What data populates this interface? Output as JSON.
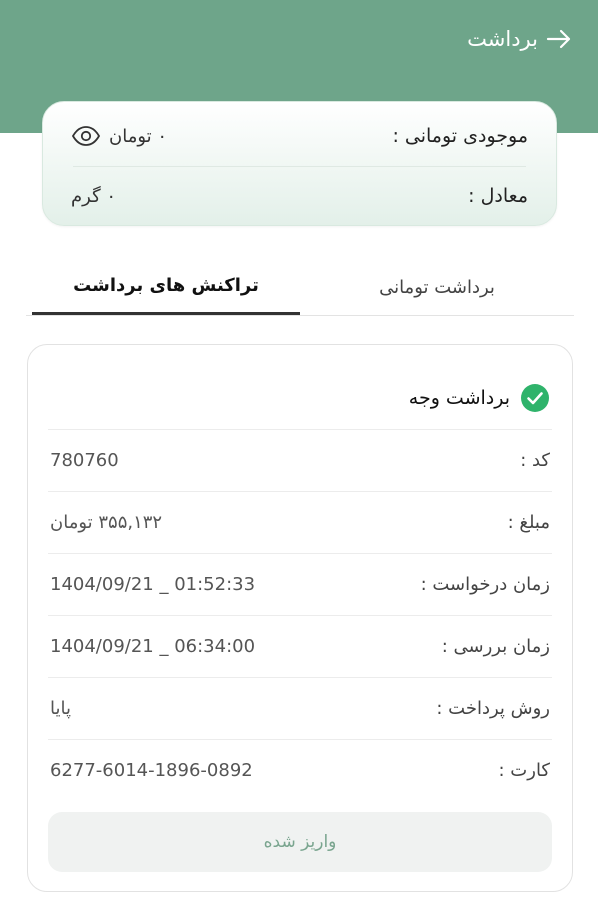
{
  "header": {
    "title": "برداشت"
  },
  "balance": {
    "toman_label": "موجودی تومانی :",
    "toman_value": "۰ تومان",
    "equiv_label": "معادل :",
    "equiv_value": "۰ گرم"
  },
  "tabs": [
    {
      "label": "برداشت تومانی",
      "active": false
    },
    {
      "label": "تراکنش های برداشت",
      "active": true
    }
  ],
  "transaction": {
    "status": "برداشت وجه",
    "rows": [
      {
        "label": "کد :",
        "value": "780760"
      },
      {
        "label": "مبلغ :",
        "value": "۳۵۵,۱۳۲ تومان"
      },
      {
        "label": "زمان درخواست :",
        "value": "1404/09/21 _ 01:52:33"
      },
      {
        "label": "زمان بررسی :",
        "value": "1404/09/21 _ 06:34:00"
      },
      {
        "label": "روش پرداخت :",
        "value": "پایا"
      },
      {
        "label": "کارت :",
        "value": "6277-6014-1896-0892"
      }
    ],
    "button_label": "واریز شده"
  },
  "colors": {
    "header_bg": "#6ea58a",
    "check_green": "#2fb36b",
    "button_text": "#7aa58f"
  },
  "icons": [
    "arrow-right-icon",
    "eye-icon",
    "check-circle-icon"
  ]
}
